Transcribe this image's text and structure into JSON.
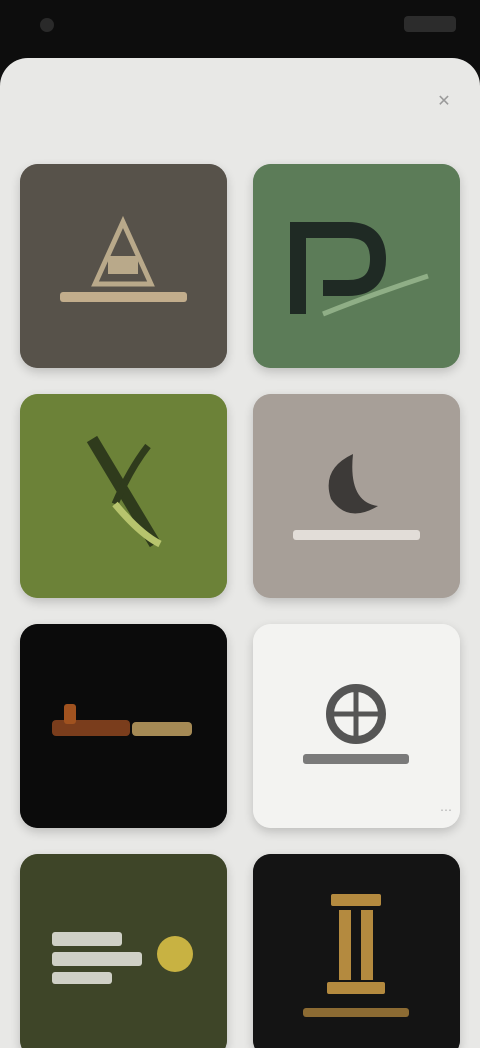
{
  "header": {
    "title": "",
    "close_icon": "close-icon"
  },
  "colors": {
    "sheet_bg": "#e8e8e6",
    "status_bg": "#0d0d0d"
  },
  "cards": [
    {
      "bg": "#57524a",
      "icon": "pyramid-logo-icon"
    },
    {
      "bg": "#5c7c58",
      "icon": "letter-p-logo-icon"
    },
    {
      "bg": "#6c8238",
      "icon": "leaf-logo-icon"
    },
    {
      "bg": "#a79f98",
      "icon": "crescent-logo-icon"
    },
    {
      "bg": "#0b0b0b",
      "icon": "wordmark-logo-icon"
    },
    {
      "bg": "#f3f3f1",
      "icon": "globe-logo-icon"
    },
    {
      "bg": "#3e4528",
      "icon": "sun-wordmark-logo-icon"
    },
    {
      "bg": "#141414",
      "icon": "pillar-logo-icon"
    }
  ]
}
